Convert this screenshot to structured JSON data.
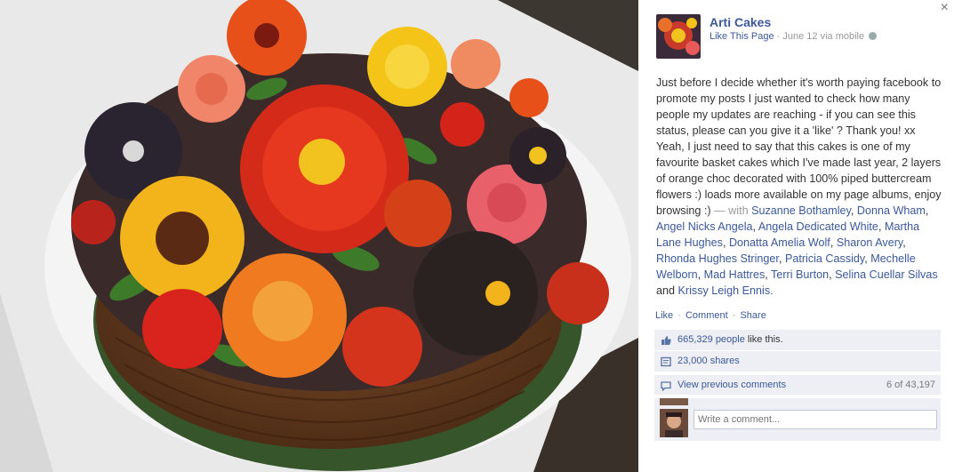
{
  "panel": {
    "close_label": "×",
    "page_name": "Arti Cakes",
    "like_page": "Like This Page",
    "date_line": "June 12 via mobile",
    "dot": "·",
    "post_intro": "Just before I decide whether it's worth paying facebook to promote my posts I just wanted to check how many people my updates are reaching - if you can see this status, please can you give it a 'like' ? Thank you! xx Yeah, I just need to say that this cakes is one of my favourite basket cakes which I've made last year, 2 layers of orange choc decorated with 100% piped buttercream flowers :) loads more available on my page albums, enjoy browsing :)",
    "with_text": "— with",
    "tagged": [
      "Suzanne Bothamley",
      "Donna Wham",
      "Angel Nicks Angela",
      "Angela Dedicated White",
      "Martha Lane Hughes",
      "Donatta Amelia Wolf",
      "Sharon Avery",
      "Rhonda Hughes Stringer",
      "Patricia Cassidy",
      "Mechelle Welborn",
      "Mad Hattres",
      "Terri Burton",
      "Selina Cuellar Silvas"
    ],
    "and_text": "and",
    "last_tagged": "Krissy Leigh Ennis.",
    "actions": {
      "like": "Like",
      "comment": "Comment",
      "share": "Share"
    },
    "likes_count": "665,329 people",
    "likes_suffix": " like this.",
    "shares": "23,000 shares",
    "view_comments": "View previous comments",
    "comments_count": "6 of 43,197",
    "comment_placeholder": "Write a comment..."
  },
  "colors": {
    "link": "#3b5998",
    "row_bg": "#edeff4",
    "meta": "#999999"
  },
  "icons": [
    "close-icon",
    "globe-icon",
    "thumbs-up-icon",
    "share-icon",
    "comment-icon"
  ]
}
